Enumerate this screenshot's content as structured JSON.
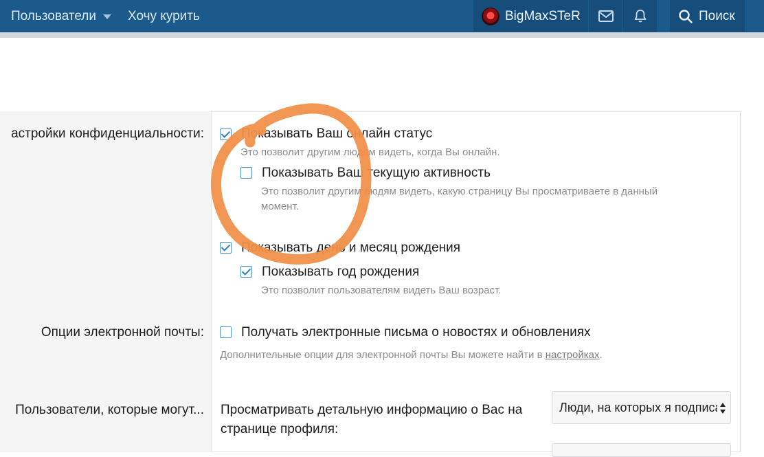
{
  "nav": {
    "members": "Пользователи",
    "want_smoke": "Хочу курить",
    "username": "BigMaxSTeR",
    "search": "Поиск"
  },
  "form": {
    "privacy_label": "астройки конфиденциальности:",
    "show_online": "Показывать Ваш онлайн статус",
    "show_online_hint": "Это позволит другим людям видеть, когда Вы онлайн.",
    "show_activity": "Показывать Ваш текущую активность",
    "show_activity_hint_1": "Это позволит другим людям видеть, какую страницу Вы просматриваете в данный",
    "show_activity_hint_2": "момент.",
    "show_dob": "Показывать день и месяц рождения",
    "show_year": "Показывать год рождения",
    "show_year_hint": "Это позволит пользователям видеть Ваш возраст.",
    "email_label": "Опции электронной почты:",
    "receive_news": "Получать электронные письма о новостях и обновлениях",
    "email_hint_pre": "Дополнительные опции для электронной почты Вы можете найти в ",
    "email_hint_link": "настройках",
    "email_hint_post": ".",
    "who_can_label": "Пользователи, которые могут...",
    "view_profile_1": "Просматривать детальную информацию о Вас на",
    "view_profile_2": "странице профиля:",
    "view_profile_value": "Люди, на которых я подписан"
  },
  "state": {
    "show_online": true,
    "show_activity": false,
    "show_dob": true,
    "show_year": true,
    "receive_news": false
  },
  "colors": {
    "nav_bg": "#1d5a8c",
    "accent": "#4d92c8",
    "annotation": "#f0904a"
  }
}
